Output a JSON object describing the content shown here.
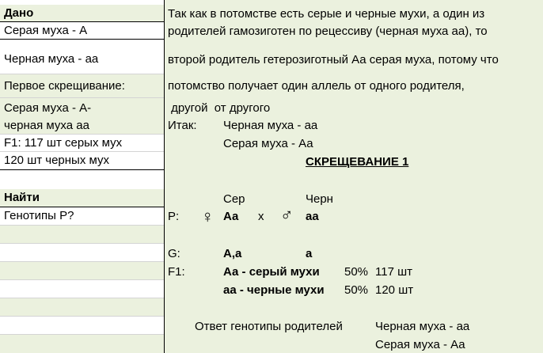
{
  "given": {
    "header": "Дано",
    "gray_fly": "Серая муха - А",
    "black_fly": "Черная муха - аа",
    "first_cross": "Первое скрещивание:",
    "cross_gray": "Серая муха - А-",
    "cross_black": "черная муха аа",
    "f1_gray": "F1: 117 шт серых мух",
    "f1_black": "120 шт черных мух"
  },
  "find": {
    "header": "Найти",
    "question": "Генотипы Р?"
  },
  "solution": {
    "line1": "Так как в потомстве есть серые и черные мухи, а один из",
    "line2": "родителей гамозиготен по рецессиву (черная муха аа), то",
    "line3": "второй  родитель гетерозиготный Аа серая муха, потому что",
    "line4": "потомство получает один аллель от одного родителя,",
    "line5": " другой  от другого",
    "itak": "Итак:",
    "itak_black": "Черная муха - аа",
    "itak_gray": "Серая муха - Аа",
    "cross_title": "СКРЕЩЕВАНИЕ  1",
    "ser": "Сер",
    "chern": "Черн",
    "p_label": "P:",
    "female_symbol": "♀",
    "p_female": "Аа",
    "times": "х",
    "male_symbol": "♂",
    "p_male": "аа",
    "g_label": "G:",
    "g_female": "А,а",
    "g_male": "а",
    "f1_label": "F1:",
    "f1_row1_genotype": "Аа - серый мухи",
    "f1_row1_percent": "50%",
    "f1_row1_count": "117 шт",
    "f1_row2_genotype": "аа - черные мухи",
    "f1_row2_percent": "50%",
    "f1_row2_count": "120 шт",
    "answer_label": "Ответ генотипы родителей",
    "answer_black": "Черная муха - аа",
    "answer_gray": "Серая муха - Аа"
  }
}
